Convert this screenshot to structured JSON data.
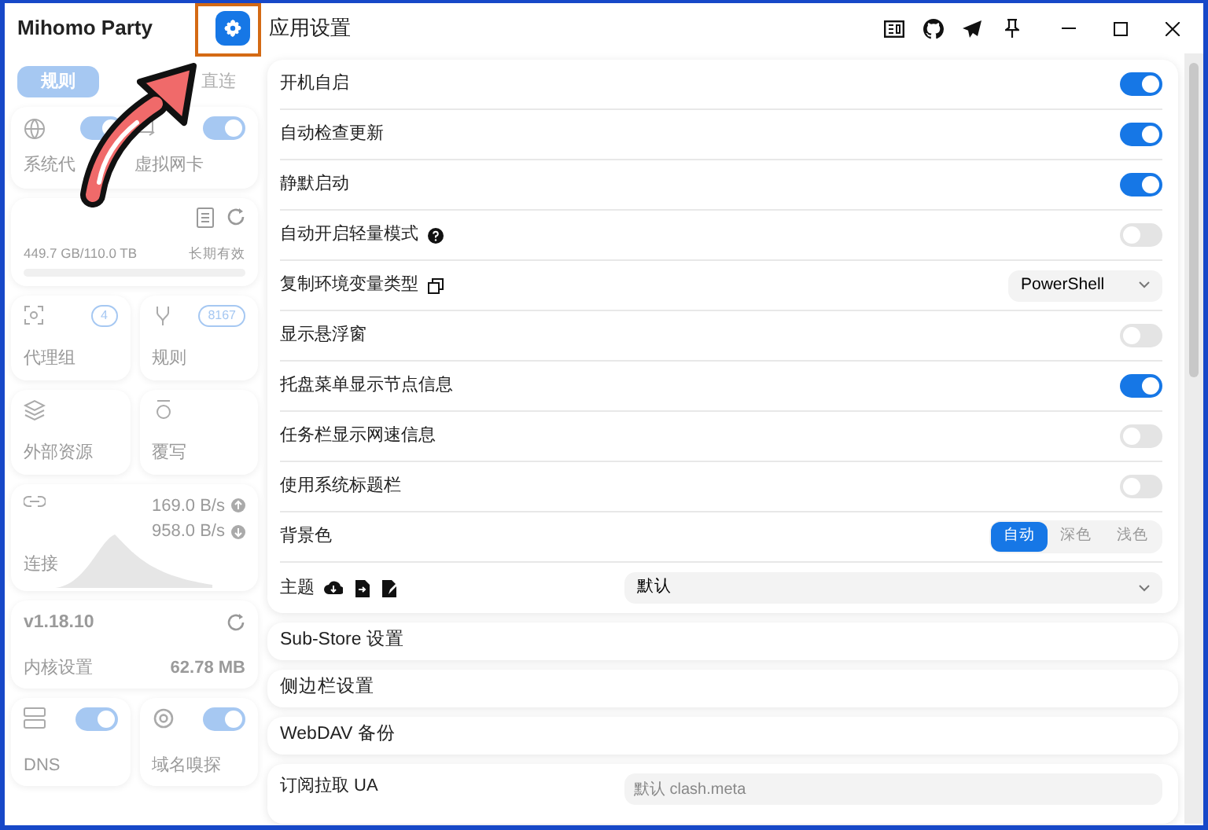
{
  "window": {
    "app_name": "Mihomo Party",
    "title": "应用设置",
    "settings_highlighted": true
  },
  "sidebar": {
    "mode_tabs": [
      {
        "label": "规则",
        "selected": true
      },
      {
        "label": "直连",
        "selected": false
      }
    ],
    "toggles": [
      {
        "label": "系统代",
        "on": true
      },
      {
        "label": "虚拟网卡",
        "on": true
      }
    ],
    "traffic": {
      "usage": "449.7 GB/110.0 TB",
      "expiry": "长期有效"
    },
    "tiles": [
      {
        "label": "代理组",
        "count": "4"
      },
      {
        "label": "规则",
        "count": "8167"
      },
      {
        "label": "外部资源"
      },
      {
        "label": "覆写"
      }
    ],
    "connections": {
      "label": "连接",
      "upload": "169.0 B/s",
      "download": "958.0 B/s"
    },
    "core": {
      "version": "v1.18.10",
      "label": "内核设置",
      "memory": "62.78 MB"
    },
    "bottom_toggles": [
      {
        "label": "DNS",
        "on": true
      },
      {
        "label": "域名嗅探",
        "on": true
      }
    ]
  },
  "settings": [
    {
      "kind": "toggle",
      "label": "开机自启",
      "on": true
    },
    {
      "kind": "toggle",
      "label": "自动检查更新",
      "on": true
    },
    {
      "kind": "toggle",
      "label": "静默启动",
      "on": true
    },
    {
      "kind": "toggle",
      "label": "自动开启轻量模式",
      "on": false,
      "help": true
    },
    {
      "kind": "select",
      "label": "复制环境变量类型",
      "value": "PowerShell"
    },
    {
      "kind": "toggle",
      "label": "显示悬浮窗",
      "on": false
    },
    {
      "kind": "toggle",
      "label": "托盘菜单显示节点信息",
      "on": true
    },
    {
      "kind": "toggle",
      "label": "任务栏显示网速信息",
      "on": false
    },
    {
      "kind": "toggle",
      "label": "使用系统标题栏",
      "on": false
    },
    {
      "kind": "segmented",
      "label": "背景色",
      "options": [
        {
          "label": "自动",
          "selected": true
        },
        {
          "label": "深色",
          "selected": false
        },
        {
          "label": "浅色",
          "selected": false
        }
      ]
    },
    {
      "kind": "theme",
      "label": "主题",
      "value": "默认"
    }
  ],
  "sections": [
    {
      "title": "Sub-Store 设置"
    },
    {
      "title": "侧边栏设置"
    },
    {
      "title": "WebDAV 备份"
    }
  ],
  "ua": {
    "label": "订阅拉取 UA",
    "placeholder": "默认 clash.meta"
  }
}
